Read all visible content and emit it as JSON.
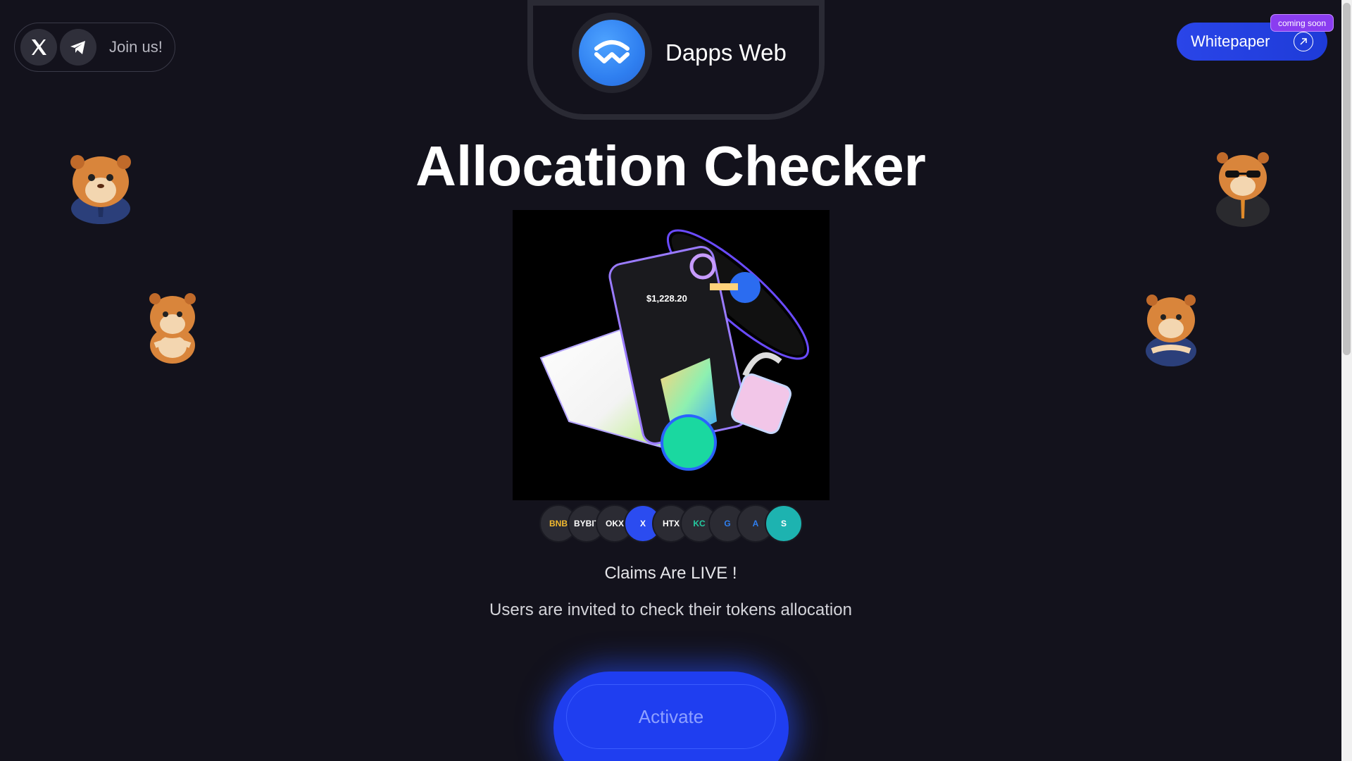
{
  "header": {
    "join_label": "Join us!",
    "social": [
      {
        "icon": "x-icon"
      },
      {
        "icon": "telegram-icon"
      }
    ],
    "brand_name": "Dapps Web",
    "whitepaper_label": "Whitepaper",
    "badge": "coming soon"
  },
  "main": {
    "title": "Allocation Checker",
    "hero_phone_balance": "$1,228.20",
    "exchanges": [
      "BNB",
      "BYBIT",
      "OKX",
      "X",
      "HTX",
      "KC",
      "G",
      "A",
      "S"
    ],
    "claims": "Claims Are LIVE !",
    "subtitle": "Users are invited to check their tokens allocation",
    "activate_label": "Activate"
  },
  "colors": {
    "background": "#13121c",
    "accent_blue": "#1f3ef0",
    "badge_purple": "#8a3df0"
  }
}
